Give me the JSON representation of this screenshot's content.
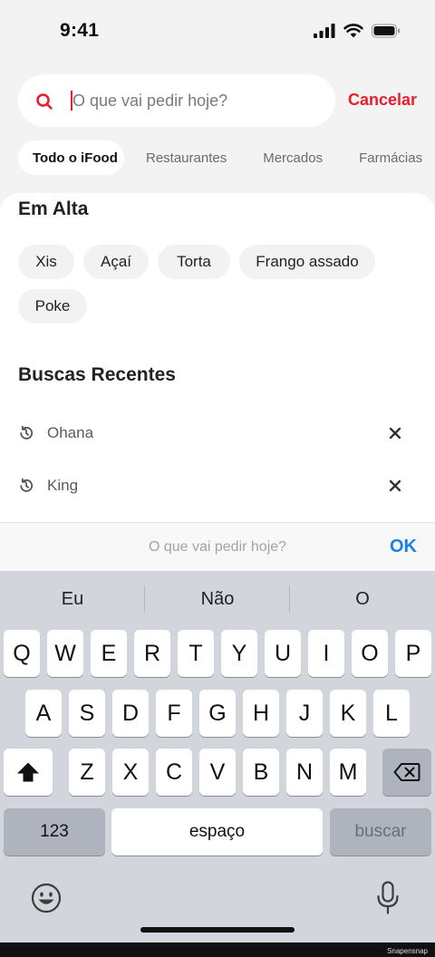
{
  "status": {
    "time": "9:41"
  },
  "search": {
    "placeholder": "O que vai pedir hoje?",
    "cancel_label": "Cancelar"
  },
  "tabs": [
    {
      "label": "Todo o iFood",
      "active": true
    },
    {
      "label": "Restaurantes",
      "active": false
    },
    {
      "label": "Mercados",
      "active": false
    },
    {
      "label": "Farmácias",
      "active": false
    }
  ],
  "trending": {
    "title": "Em Alta",
    "chips": [
      "Xis",
      "Açaí",
      "Torta",
      "Frango assado",
      "Poke"
    ]
  },
  "recent": {
    "title": "Buscas Recentes",
    "items": [
      "Ohana",
      "King"
    ]
  },
  "accessory": {
    "placeholder": "O que vai pedir hoje?",
    "ok_label": "OK"
  },
  "keyboard": {
    "suggestions": [
      "Eu",
      "Não",
      "O"
    ],
    "row1": [
      "Q",
      "W",
      "E",
      "R",
      "T",
      "Y",
      "U",
      "I",
      "O",
      "P"
    ],
    "row2": [
      "A",
      "S",
      "D",
      "F",
      "G",
      "H",
      "J",
      "K",
      "L"
    ],
    "row3": [
      "Z",
      "X",
      "C",
      "V",
      "B",
      "N",
      "M"
    ],
    "numbers_label": "123",
    "space_label": "espaço",
    "search_label": "buscar"
  },
  "watermark": "Snapensnap",
  "colors": {
    "brand": "#ea1d2c",
    "ok_blue": "#1a7fe8",
    "keyboard_bg": "#d2d5db"
  }
}
